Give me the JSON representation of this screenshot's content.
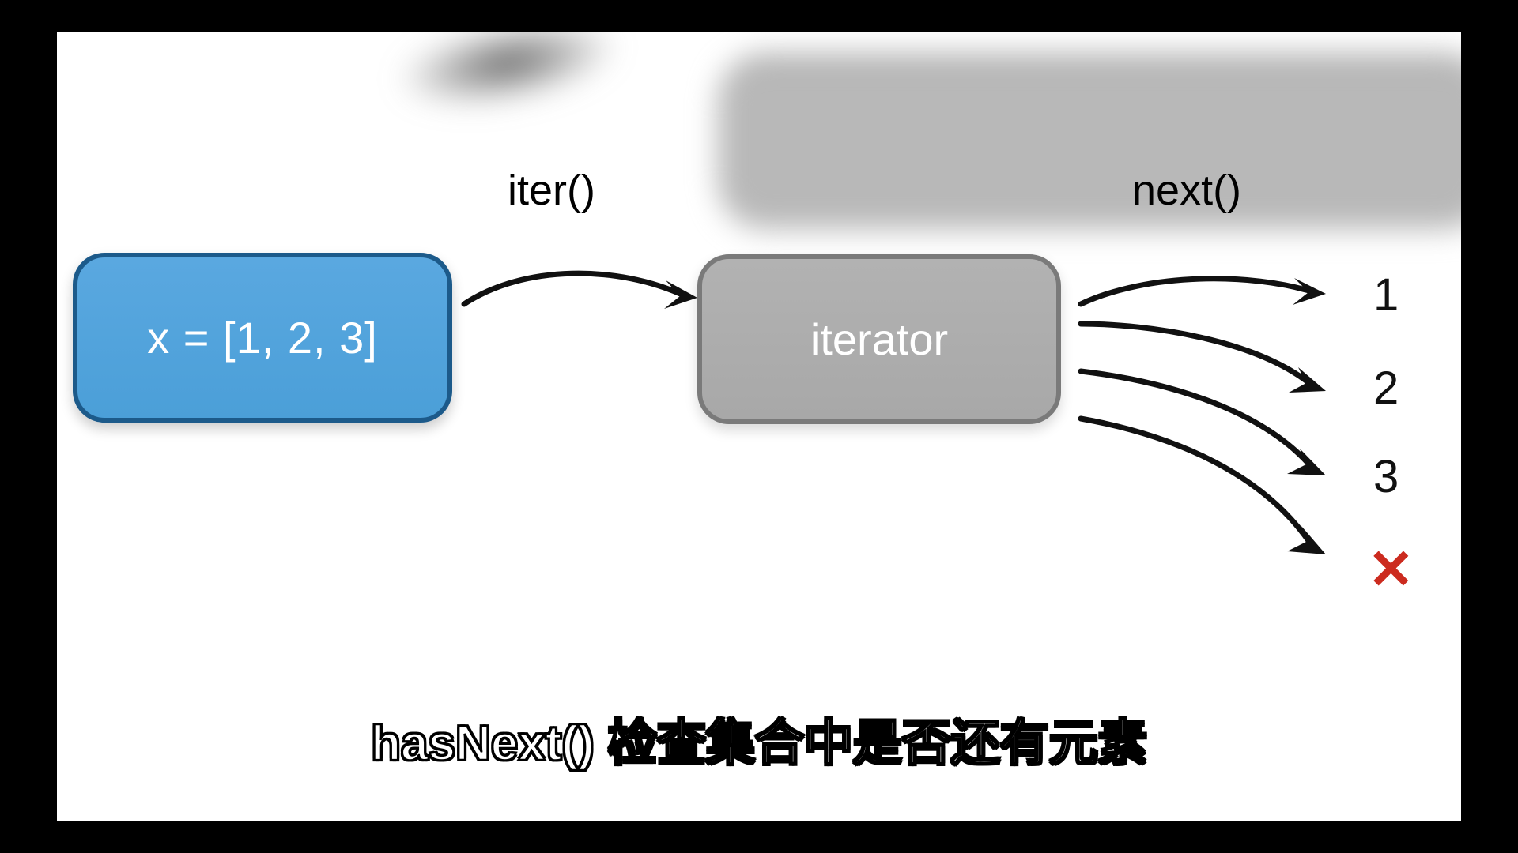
{
  "labels": {
    "iter": "iter()",
    "next": "next()"
  },
  "boxes": {
    "list": "x = [1, 2, 3]",
    "iterator": "iterator"
  },
  "outputs": {
    "v1": "1",
    "v2": "2",
    "v3": "3",
    "stop": "✕"
  },
  "subtitle": "hasNext() 检查集合中是否还有元素"
}
